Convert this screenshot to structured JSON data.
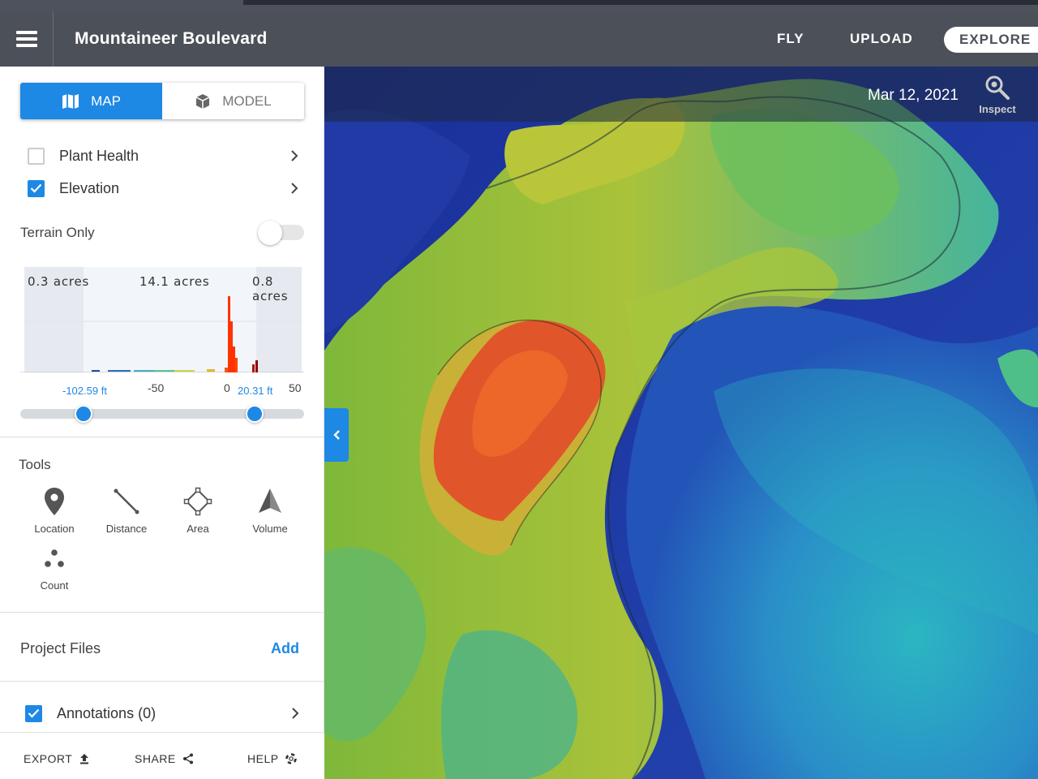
{
  "header": {
    "project_title": "Mountaineer Boulevard",
    "nav": {
      "fly": "FLY",
      "upload": "UPLOAD",
      "explore": "EXPLORE"
    }
  },
  "view_toggle": {
    "map": "MAP",
    "model": "MODEL",
    "selected": "MAP"
  },
  "layers": [
    {
      "label": "Plant Health",
      "checked": false
    },
    {
      "label": "Elevation",
      "checked": true
    }
  ],
  "terrain_only": {
    "label": "Terrain Only",
    "enabled": false
  },
  "histogram": {
    "acres_left": "0.3 acres",
    "acres_mid": "14.1 acres",
    "acres_right": "0.8 acres",
    "ticks": [
      "-50",
      "0",
      "50"
    ],
    "low_value": "-102.59 ft",
    "high_value": "20.31 ft"
  },
  "tools": {
    "title": "Tools",
    "items": [
      {
        "label": "Location",
        "icon": "location-pin-icon"
      },
      {
        "label": "Distance",
        "icon": "distance-line-icon"
      },
      {
        "label": "Area",
        "icon": "area-polygon-icon"
      },
      {
        "label": "Volume",
        "icon": "volume-pyramid-icon"
      },
      {
        "label": "Count",
        "icon": "count-dots-icon"
      }
    ]
  },
  "project_files": {
    "title": "Project Files",
    "add": "Add"
  },
  "annotations": {
    "label": "Annotations (0)",
    "checked": true
  },
  "footer": {
    "export": "EXPORT",
    "share": "SHARE",
    "help": "HELP"
  },
  "map": {
    "date": "Mar 12, 2021",
    "inspect": "Inspect"
  },
  "colors": {
    "accent": "#1e88e5",
    "header": "#4c5059"
  }
}
